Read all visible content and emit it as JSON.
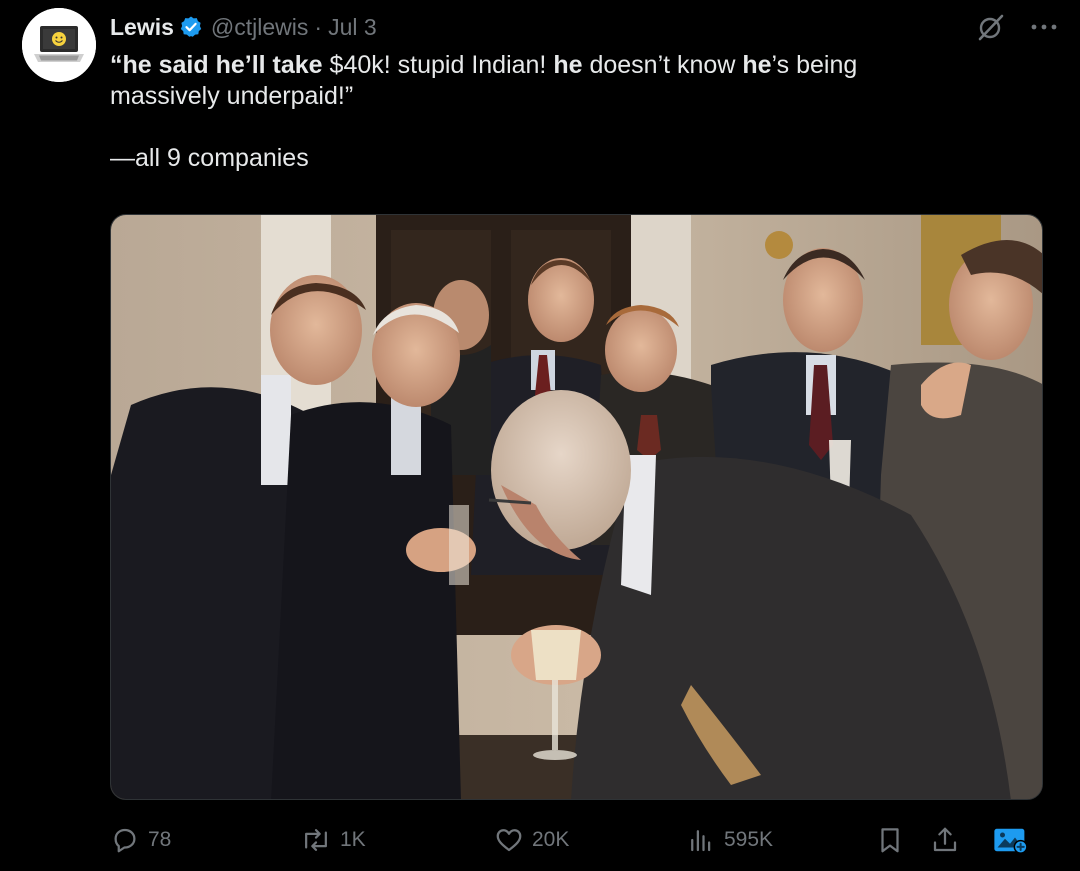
{
  "tweet": {
    "author_name": "Lewis",
    "author_handle": "@ctjlewis",
    "separator": "·",
    "date": "Jul 3",
    "text_segments": {
      "s1": "“he said he’ll take",
      "s2": " $40k",
      "s3": "! stupid Indian! ",
      "s4": "he",
      "s5": " doesn’t know ",
      "s6": "he",
      "s7": "’s being"
    },
    "text_line2": "massively underpaid!”",
    "text_line3": "—all 9 companies"
  },
  "actions": {
    "replies": "78",
    "reposts": "1K",
    "likes": "20K",
    "views": "595K"
  },
  "icons": {
    "avatar": "laptop-smiley-icon",
    "verified": "verified-badge-icon",
    "grok": "grok-icon",
    "more": "more-icon",
    "reply": "reply-icon",
    "repost": "repost-icon",
    "like": "heart-icon",
    "views": "views-icon",
    "bookmark": "bookmark-icon",
    "share": "share-icon",
    "image": "image-icon"
  },
  "colors": {
    "background": "#000000",
    "text": "#e7e9ea",
    "muted": "#71767b",
    "verified": "#1d9bf0"
  }
}
